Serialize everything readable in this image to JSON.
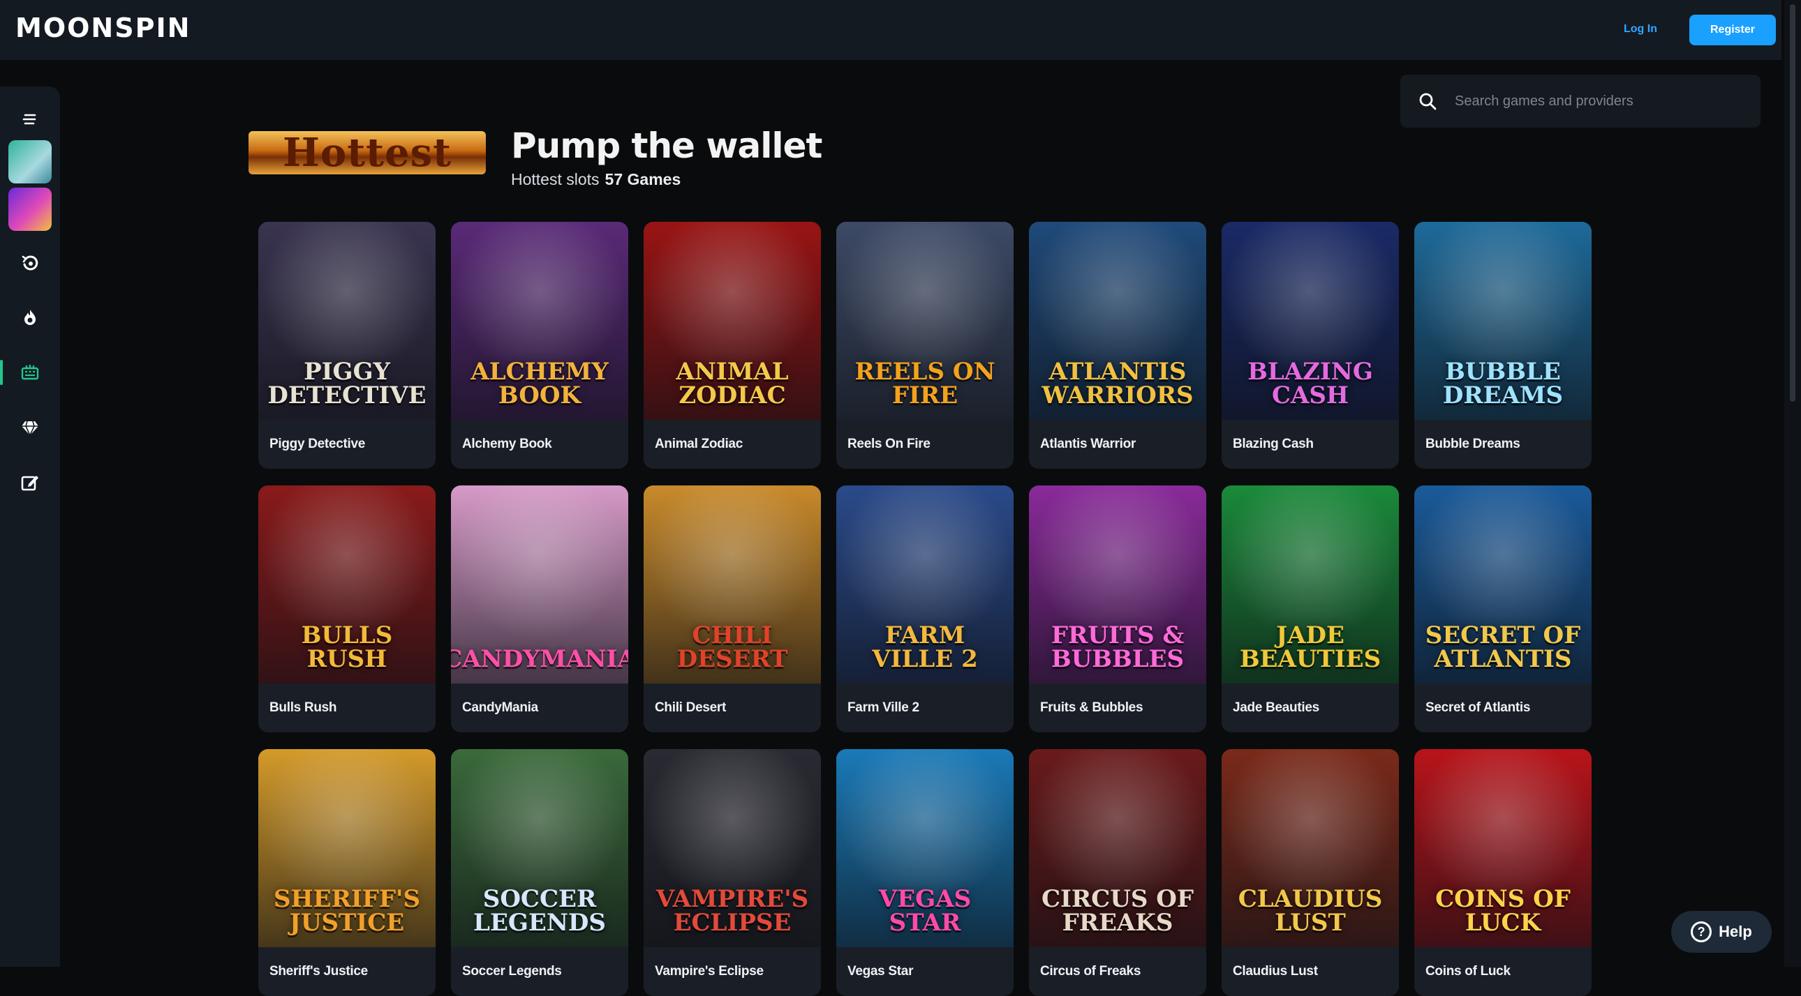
{
  "header": {
    "logo": "MOONSPIN",
    "login_label": "Log In",
    "register_label": "Register"
  },
  "sidebar": {
    "items": [
      {
        "icon": "menu-icon"
      },
      {
        "icon": "game-thumbnail-icon"
      },
      {
        "icon": "game-thumbnail-icon"
      },
      {
        "icon": "recent-icon"
      },
      {
        "icon": "fire-icon"
      },
      {
        "icon": "slot-machine-icon",
        "active": true
      },
      {
        "icon": "diamond-icon"
      },
      {
        "icon": "edit-icon"
      }
    ]
  },
  "search": {
    "placeholder": "Search games and providers"
  },
  "heading": {
    "badge": "Hottest",
    "title": "Pump the wallet",
    "subtitle": "Hottest slots",
    "count": "57 Games"
  },
  "games": [
    {
      "name": "Piggy Detective",
      "art": "PIGGY DETECTIVE",
      "bg": "#3a3450",
      "fg": "#e8e2d2"
    },
    {
      "name": "Alchemy Book",
      "art": "ALCHEMY BOOK",
      "bg": "#5a2a78",
      "fg": "#f2b23c"
    },
    {
      "name": "Animal Zodiac",
      "art": "ANIMAL ZODIAC",
      "bg": "#9a1414",
      "fg": "#f4c94a"
    },
    {
      "name": "Reels On Fire",
      "art": "REELS ON FIRE",
      "bg": "#3d4a66",
      "fg": "#f3a21c"
    },
    {
      "name": "Atlantis Warrior",
      "art": "ATLANTIS WARRIORS",
      "bg": "#1f4a7a",
      "fg": "#f0c040"
    },
    {
      "name": "Blazing Cash",
      "art": "BLAZING CASH",
      "bg": "#1a2a66",
      "fg": "#e46ae0"
    },
    {
      "name": "Bubble Dreams",
      "art": "BUBBLE DREAMS",
      "bg": "#1e6a9a",
      "fg": "#9ee2ff"
    },
    {
      "name": "Bulls Rush",
      "art": "BULLS RUSH",
      "bg": "#8a1a1a",
      "fg": "#f2b93a"
    },
    {
      "name": "CandyMania",
      "art": "CANDYMANIA",
      "bg": "#d69ac8",
      "fg": "#ff4fa8"
    },
    {
      "name": "Chili Desert",
      "art": "CHILI DESERT",
      "bg": "#c98a2a",
      "fg": "#e0422a"
    },
    {
      "name": "Farm Ville 2",
      "art": "FARM VILLE 2",
      "bg": "#2a4a8a",
      "fg": "#f3b83c"
    },
    {
      "name": "Fruits & Bubbles",
      "art": "FRUITS & BUBBLES",
      "bg": "#8a2a9a",
      "fg": "#ff6ad8"
    },
    {
      "name": "Jade Beauties",
      "art": "JADE BEAUTIES",
      "bg": "#1a8a3a",
      "fg": "#f0c83a"
    },
    {
      "name": "Secret of Atlantis",
      "art": "SECRET OF ATLANTIS",
      "bg": "#1a5a9a",
      "fg": "#f2c84a"
    },
    {
      "name": "Sheriff's Justice",
      "art": "SHERIFF'S JUSTICE",
      "bg": "#d49a2a",
      "fg": "#f2a02a"
    },
    {
      "name": "Soccer Legends",
      "art": "SOCCER LEGENDS",
      "bg": "#3a6a3a",
      "fg": "#d8e6ff"
    },
    {
      "name": "Vampire's Eclipse",
      "art": "VAMPIRE'S ECLIPSE",
      "bg": "#2a2a32",
      "fg": "#e24a3a"
    },
    {
      "name": "Vegas Star",
      "art": "VEGAS STAR",
      "bg": "#1a7ab8",
      "fg": "#ff4aa8"
    },
    {
      "name": "Circus of Freaks",
      "art": "CIRCUS OF FREAKS",
      "bg": "#6a1a1a",
      "fg": "#e8d8c8"
    },
    {
      "name": "Claudius Lust",
      "art": "CLAUDIUS LUST",
      "bg": "#7a2a1a",
      "fg": "#f2c84a"
    },
    {
      "name": "Coins of Luck",
      "art": "COINS OF LUCK",
      "bg": "#b8141a",
      "fg": "#ffd24a"
    }
  ],
  "help": {
    "label": "Help"
  }
}
